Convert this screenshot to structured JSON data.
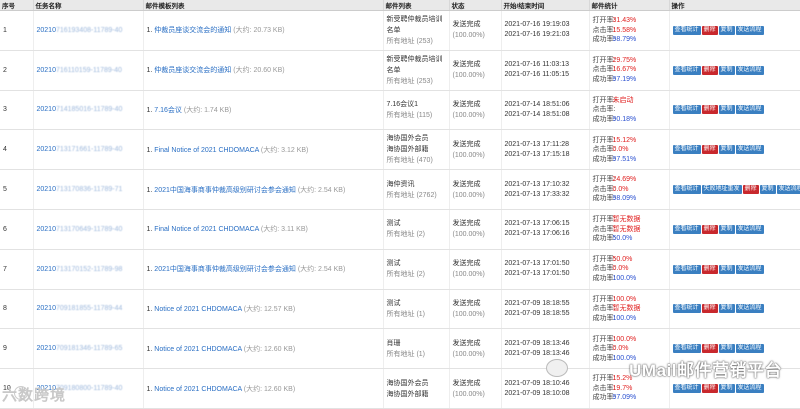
{
  "headers": {
    "seq": "序号",
    "task": "任务名称",
    "template": "邮件模板列表",
    "mailing": "邮件列表",
    "status": "状态",
    "time": "开始/结束时间",
    "stats": "邮件统计",
    "ops": "操作"
  },
  "stat_labels": {
    "open": "打开率:",
    "click": "点击率:",
    "success": "成功率:"
  },
  "op_labels": {
    "view": "查看统计",
    "delete": "删除",
    "copy": "复制",
    "flow": "发送流程",
    "resend": "失败地址重发"
  },
  "rows": [
    {
      "seq": "1",
      "task_prefix": "20210",
      "task_rest": "716193408-11789-40",
      "tpl_num": "1.",
      "tpl_title": "仲裁员座谈交流会的通知",
      "tpl_size": "(大约: 20.73 KB)",
      "list_name": "新受聘仲裁员培训名单",
      "list_addr": "所有地址 (253)",
      "status": "发送完成",
      "status_pct": "(100.00%)",
      "start": "2021-07-16 19:19:03",
      "end": "2021-07-16 19:21:03",
      "open": "31.43%",
      "click": "15.58%",
      "success": "98.79%"
    },
    {
      "seq": "2",
      "task_prefix": "20210",
      "task_rest": "716110159-11789-40",
      "tpl_num": "1.",
      "tpl_title": "仲裁员座谈交流会的通知",
      "tpl_size": "(大约: 20.60 KB)",
      "list_name": "新受聘仲裁员培训名单",
      "list_addr": "所有地址 (253)",
      "status": "发送完成",
      "status_pct": "(100.00%)",
      "start": "2021-07-16 11:03:13",
      "end": "2021-07-16 11:05:15",
      "open": "29.75%",
      "click": "16.67%",
      "success": "97.19%"
    },
    {
      "seq": "3",
      "task_prefix": "20210",
      "task_rest": "714185016-11789-40",
      "tpl_num": "1.",
      "tpl_title": "7.16会议",
      "tpl_size": "(大约: 1.74 KB)",
      "list_name": "7.16会议1",
      "list_addr": "所有地址 (115)",
      "status": "发送完成",
      "status_pct": "(100.00%)",
      "start": "2021-07-14 18:51:06",
      "end": "2021-07-14 18:51:08",
      "open": "未启动",
      "click": "",
      "success": "90.18%"
    },
    {
      "seq": "4",
      "task_prefix": "20210",
      "task_rest": "713171661-11789-40",
      "tpl_num": "1.",
      "tpl_title": "Final Notice of 2021 CHDOMACA",
      "tpl_size": "(大约: 3.12 KB)",
      "list_name": "海协国外会员",
      "list_name2": "海协国外部籍",
      "list_addr": "所有地址 (470)",
      "status": "发送完成",
      "status_pct": "(100.00%)",
      "start": "2021-07-13 17:11:28",
      "end": "2021-07-13 17:15:18",
      "open": "15.12%",
      "click": "0.0%",
      "success": "97.51%"
    },
    {
      "seq": "5",
      "task_prefix": "20210",
      "task_rest": "713170836-11789-71",
      "tpl_num": "1.",
      "tpl_title": "2021中国海事商事仲裁高级别研讨会参会通知",
      "tpl_size": "(大约: 2.54 KB)",
      "list_name": "海仲资讯",
      "list_addr": "所有地址 (2762)",
      "status": "发送完成",
      "status_pct": "(100.00%)",
      "start": "2021-07-13 17:10:32",
      "end": "2021-07-13 17:33:32",
      "open": "24.69%",
      "click": "0.0%",
      "success": "98.09%"
    },
    {
      "seq": "6",
      "task_prefix": "20210",
      "task_rest": "713170649-11789-40",
      "tpl_num": "1.",
      "tpl_title": "Final Notice of 2021 CHDOMACA",
      "tpl_size": "(大约: 3.11 KB)",
      "list_name": "测试",
      "list_addr": "所有地址 (2)",
      "status": "发送完成",
      "status_pct": "(100.00%)",
      "start": "2021-07-13 17:06:15",
      "end": "2021-07-13 17:06:16",
      "open": "暂无数据",
      "click": "暂无数据",
      "success": "50.0%"
    },
    {
      "seq": "7",
      "task_prefix": "20210",
      "task_rest": "713170152-11789-98",
      "tpl_num": "1.",
      "tpl_title": "2021中国海事商事仲裁高级别研讨会参会通知",
      "tpl_size": "(大约: 2.54 KB)",
      "list_name": "测试",
      "list_addr": "所有地址 (2)",
      "status": "发送完成",
      "status_pct": "(100.00%)",
      "start": "2021-07-13 17:01:50",
      "end": "2021-07-13 17:01:50",
      "open": "50.0%",
      "click": "0.0%",
      "success": "100.0%"
    },
    {
      "seq": "8",
      "task_prefix": "20210",
      "task_rest": "709181855-11789-44",
      "tpl_num": "1.",
      "tpl_title": "Notice of 2021 CHDOMACA",
      "tpl_size": "(大约: 12.57 KB)",
      "list_name": "测试",
      "list_addr": "所有地址 (1)",
      "status": "发送完成",
      "status_pct": "(100.00%)",
      "start": "2021-07-09 18:18:55",
      "end": "2021-07-09 18:18:55",
      "open": "100.0%",
      "click": "暂无数据",
      "success": "100.0%"
    },
    {
      "seq": "9",
      "task_prefix": "20210",
      "task_rest": "709181346-11789-65",
      "tpl_num": "1.",
      "tpl_title": "Notice of 2021 CHDOMACA",
      "tpl_size": "(大约: 12.60 KB)",
      "list_name": "肖珊",
      "list_addr": "所有地址 (1)",
      "status": "发送完成",
      "status_pct": "(100.00%)",
      "start": "2021-07-09 18:13:46",
      "end": "2021-07-09 18:13:46",
      "open": "100.0%",
      "click": "0.0%",
      "success": "100.0%"
    },
    {
      "seq": "10",
      "task_prefix": "20210",
      "task_rest": "709180800-11789-40",
      "tpl_num": "1.",
      "tpl_title": "Notice of 2021 CHDOMACA",
      "tpl_size": "(大约: 12.60 KB)",
      "list_name": "海协国外会员",
      "list_name2": "海协国外部籍",
      "list_addr": "",
      "status": "发送完成",
      "status_pct": "(100.00%)",
      "start": "2021-07-09 18:10:46",
      "end": "2021-07-09 18:10:08",
      "open": "15.2%",
      "click": "19.7%",
      "success": "97.09%"
    }
  ],
  "row5_has_resend": true,
  "watermark_left": "六数跨境",
  "watermark_right": "UMail邮件营销平台"
}
